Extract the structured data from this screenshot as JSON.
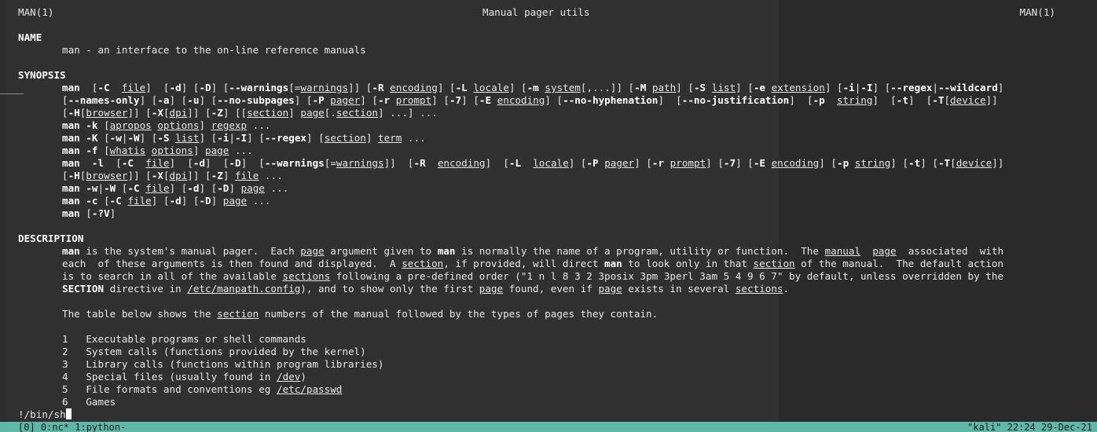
{
  "header": {
    "left": "MAN(1)",
    "center": "Manual pager utils",
    "right": "MAN(1)"
  },
  "name_section": {
    "heading": "NAME",
    "text": "man - an interface to the on-line reference manuals"
  },
  "synopsis": {
    "heading": "SYNOPSIS"
  },
  "description": {
    "heading": "DESCRIPTION",
    "table_intro_a": "The table below shows the ",
    "table_intro_link": "section",
    "table_intro_b": " numbers of the manual followed by the types of pages they contain.",
    "sections": [
      {
        "num": "1",
        "desc": "Executable programs or shell commands"
      },
      {
        "num": "2",
        "desc": "System calls (functions provided by the kernel)"
      },
      {
        "num": "3",
        "desc": "Library calls (functions within program libraries)"
      },
      {
        "num": "4",
        "desc": "Special files (usually found in ",
        "link": "/dev",
        "after": ")"
      },
      {
        "num": "5",
        "desc": "File formats and conventions eg ",
        "link": "/etc/passwd",
        "after": ""
      },
      {
        "num": "6",
        "desc": "Games"
      }
    ]
  },
  "prompt": {
    "text": "!/bin/sh"
  },
  "statusbar": {
    "left": "[0] 0:nc* 1:python-",
    "right": "\"kali\" 22:24 29-Dec-21"
  },
  "colors": {
    "status_bg": "#5fb8a7",
    "terminal_bg": "#303030"
  }
}
